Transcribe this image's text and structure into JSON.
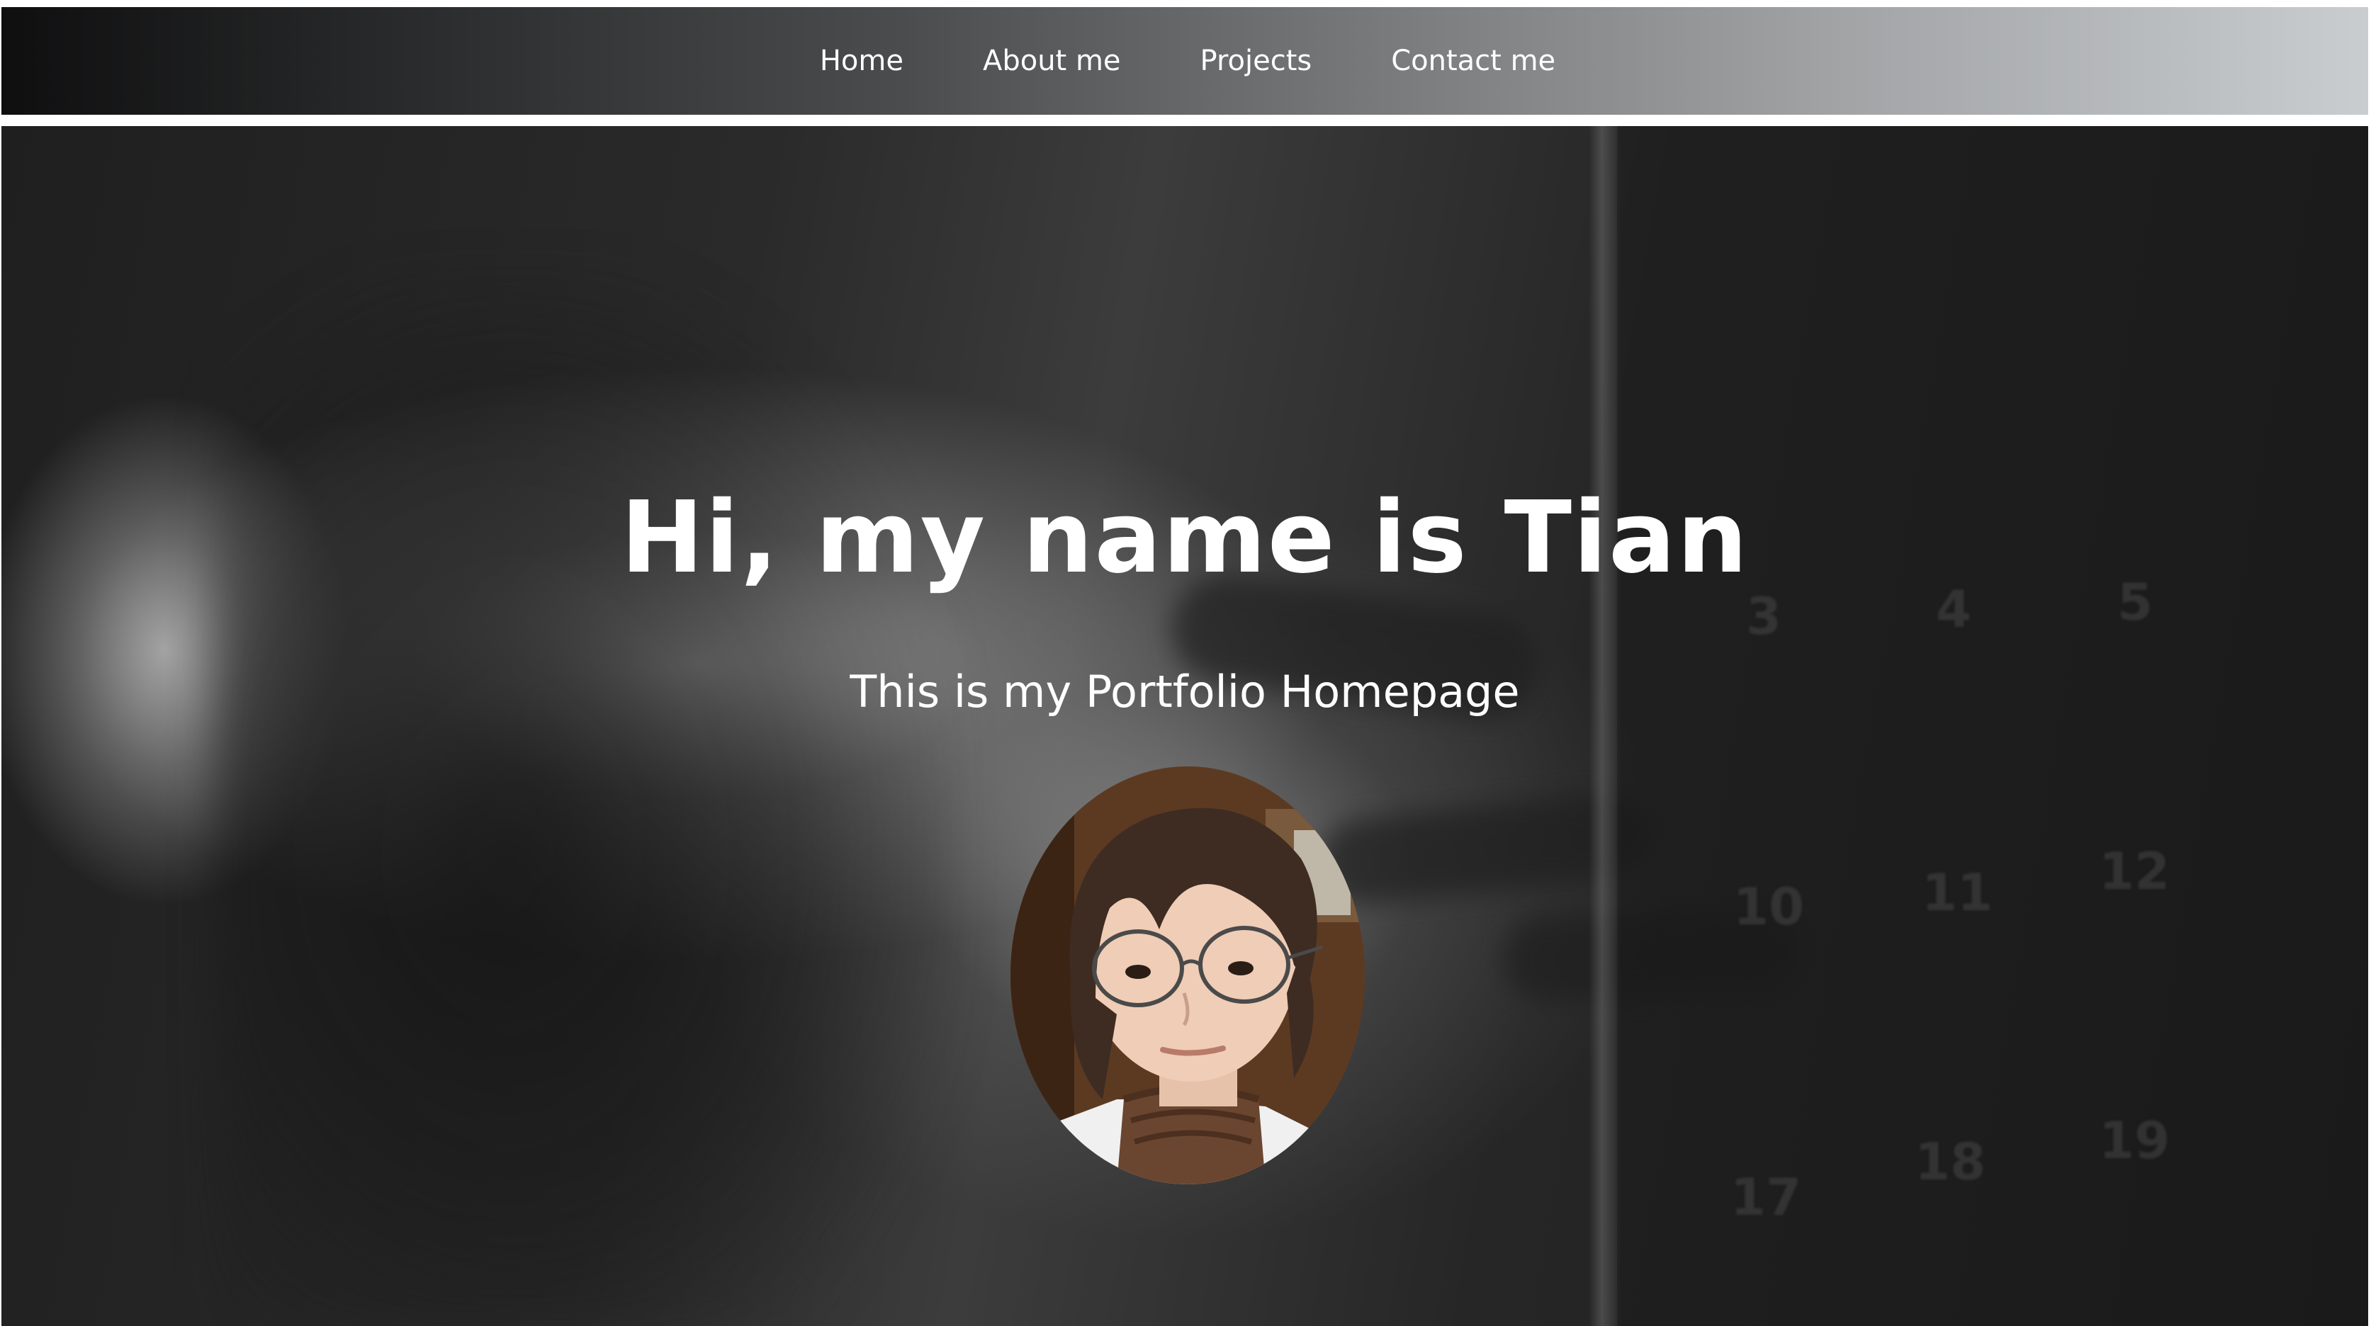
{
  "nav": {
    "items": [
      {
        "label": "Home"
      },
      {
        "label": "About me"
      },
      {
        "label": "Projects"
      },
      {
        "label": "Contact me"
      }
    ]
  },
  "hero": {
    "title": "Hi, my name is Tian",
    "subtitle": "This is my Portfolio Homepage",
    "background": {
      "calendar_numbers": [
        "3",
        "4",
        "5",
        "10",
        "11",
        "12",
        "17",
        "18",
        "19"
      ]
    }
  },
  "colors": {
    "nav_text": "#ffffff",
    "hero_text": "#ffffff",
    "nav_gradient_start": "#0f0f10",
    "nav_gradient_end": "#c9cdd0"
  }
}
